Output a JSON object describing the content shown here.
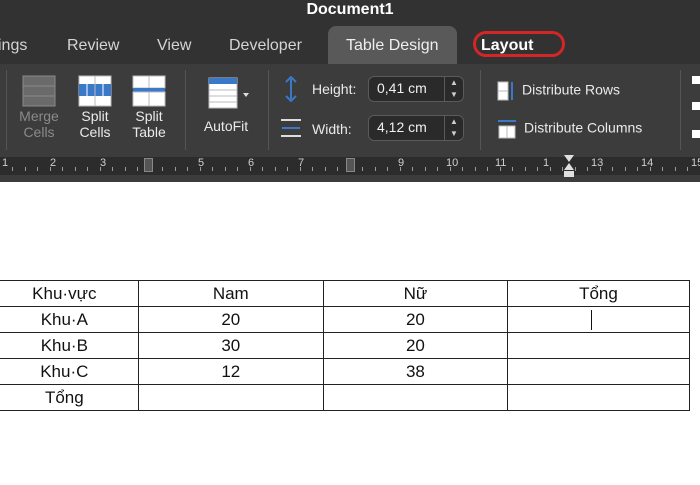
{
  "window": {
    "title": "Document1"
  },
  "tabs": [
    {
      "label": "ings"
    },
    {
      "label": "Review"
    },
    {
      "label": "View"
    },
    {
      "label": "Developer"
    },
    {
      "label": "Table Design"
    },
    {
      "label": "Layout"
    }
  ],
  "ribbon": {
    "merge": {
      "label1": "Merge",
      "label2": "Cells"
    },
    "split_cells": {
      "label1": "Split",
      "label2": "Cells"
    },
    "split_table": {
      "label1": "Split",
      "label2": "Table"
    },
    "autofit": {
      "label": "AutoFit"
    },
    "height": {
      "label": "Height:",
      "value": "0,41 cm"
    },
    "width": {
      "label": "Width:",
      "value": "4,12 cm"
    },
    "distribute_rows": "Distribute Rows",
    "distribute_columns": "Distribute Columns"
  },
  "ruler": {
    "numbers": [
      "1",
      "2",
      "3",
      "5",
      "6",
      "7",
      "9",
      "10",
      "11",
      "1",
      "13",
      "14",
      "15"
    ]
  },
  "table": {
    "headers": [
      "Khu·vực",
      "Nam",
      "Nữ",
      "Tổng"
    ],
    "rows": [
      [
        "Khu·A",
        "20",
        "20",
        ""
      ],
      [
        "Khu·B",
        "30",
        "20",
        ""
      ],
      [
        "Khu·C",
        "12",
        "38",
        ""
      ],
      [
        "Tổng",
        "",
        "",
        ""
      ]
    ]
  },
  "colors": {
    "highlight": "#d42626",
    "ribbon_bg": "#3c3c3c",
    "icon_blue": "#3a78c8"
  }
}
